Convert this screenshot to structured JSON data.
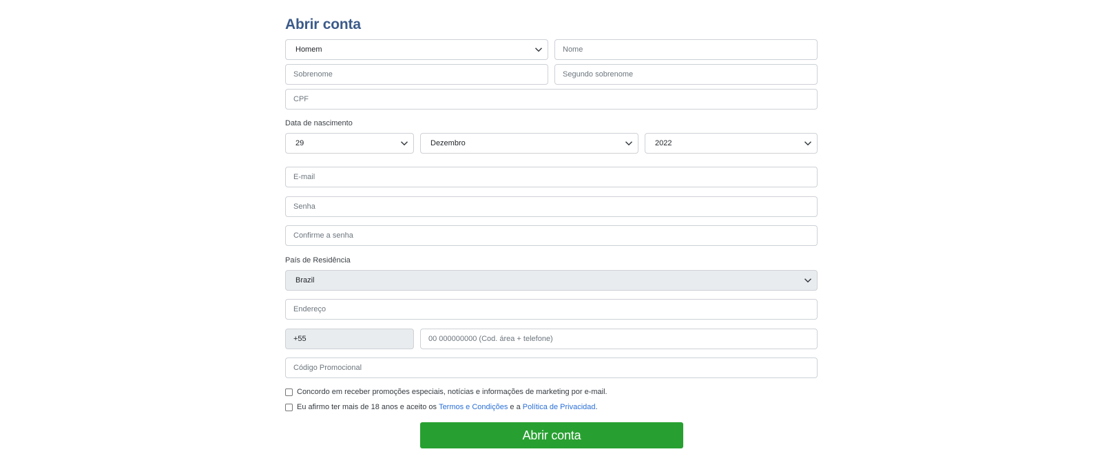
{
  "page_title": "Abrir conta",
  "gender": {
    "selected": "Homem"
  },
  "fields": {
    "nome": "Nome",
    "sobrenome": "Sobrenome",
    "segundo_sobrenome": "Segundo sobrenome",
    "cpf": "CPF",
    "email": "E-mail",
    "senha": "Senha",
    "confirme_senha": "Confirme a senha",
    "endereco": "Endereço",
    "phone_prefix": "+55",
    "telefone": "00 000000000 (Cod. área + telefone)",
    "codigo_promocional": "Código Promocional"
  },
  "birthdate": {
    "label": "Data de nascimento",
    "day": "29",
    "month": "Dezembro",
    "year": "2022"
  },
  "country": {
    "label": "País de Residência",
    "selected": "Brazil"
  },
  "checkboxes": {
    "marketing": {
      "checked": false,
      "text": "Concordo em receber promoções especiais, notícias e informações de marketing por e-mail."
    },
    "terms": {
      "checked": false,
      "text_before": "Eu afirmo ter mais de 18 anos e aceito os ",
      "terms_link": "Termos e Condições",
      "text_middle": " e a ",
      "privacy_link": "Política de Privacidad",
      "text_after": "."
    }
  },
  "submit_label": "Abrir conta",
  "colors": {
    "title": "#3b5a89",
    "submit": "#28a031",
    "link": "#2a6fd6",
    "readonly_bg": "#e9ecef"
  },
  "icons": [
    "chevron-down-icon"
  ]
}
